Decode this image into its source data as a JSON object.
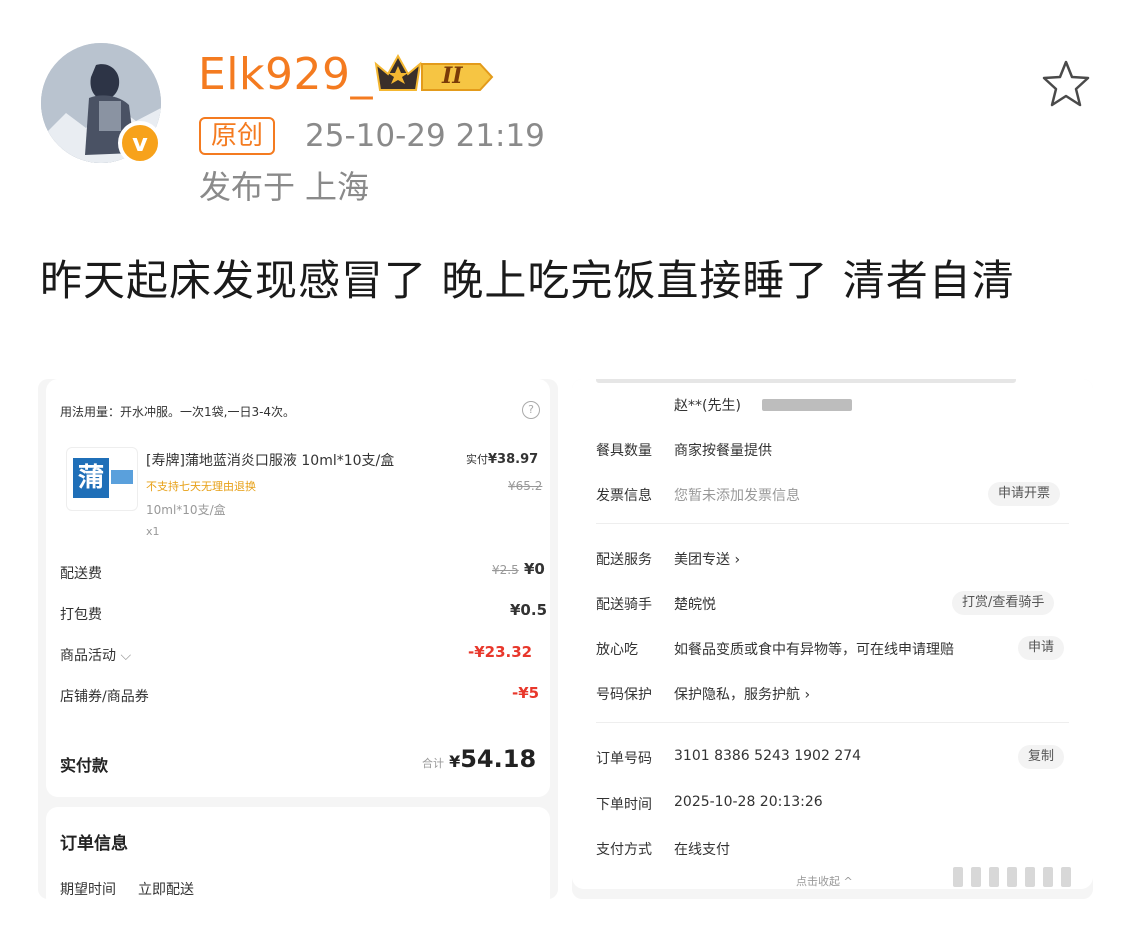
{
  "post": {
    "username": "Elk929_",
    "level_badge": "II",
    "verified_badge": "v",
    "original_tag": "原创",
    "timestamp": "25-10-29 21:19",
    "location_prefix": "发布于",
    "location": "上海",
    "text": "昨天起床发现感冒了 晚上吃完饭直接睡了 清者自清",
    "icons": [
      "avatar",
      "verified-badge-icon",
      "crown-level-icon",
      "favorite-star-icon"
    ]
  },
  "left_screenshot": {
    "usage": "用法用量：开水冲服。一次1袋,一日3-4次。",
    "product": {
      "name": "[寿牌]蒲地蓝消炎口服液 10ml*10支/盒",
      "notice": "不支持七天无理由退换",
      "spec": "10ml*10支/盒",
      "qty": "x1",
      "paid_label": "实付",
      "paid_price": "¥38.97",
      "original_price": "¥65.2",
      "image_char": "蒲"
    },
    "fees": [
      {
        "label": "配送费",
        "old": "¥2.5",
        "value": "¥0"
      },
      {
        "label": "打包费",
        "old": "",
        "value": "¥0.5"
      },
      {
        "label": "商品活动",
        "old": "",
        "value": "-¥23.32"
      },
      {
        "label": "店铺券/商品券",
        "old": "",
        "value": "-¥5"
      }
    ],
    "total_label": "实付款",
    "total_prefix": "合计",
    "total_currency": "¥",
    "total_value": "54.18",
    "order_info_title": "订单信息",
    "expected_label": "期望时间",
    "expected_value": "立即配送"
  },
  "right_screenshot": {
    "recipient": "赵**(先生)",
    "rows_a": [
      {
        "label": "餐具数量",
        "value": "商家按餐量提供",
        "action": ""
      },
      {
        "label": "发票信息",
        "value": "您暂未添加发票信息",
        "action": "申请开票"
      }
    ],
    "rows_b": [
      {
        "label": "配送服务",
        "value": "美团专送 ›",
        "action": ""
      },
      {
        "label": "配送骑手",
        "value": "楚皖悦",
        "action": "打赏/查看骑手"
      },
      {
        "label": "放心吃",
        "value": "如餐品变质或食中有异物等，可在线申请理赔",
        "action": "申请"
      },
      {
        "label": "号码保护",
        "value": "保护隐私，服务护航 ›",
        "action": ""
      }
    ],
    "rows_c": [
      {
        "label": "订单号码",
        "value": "3101 8386 5243 1902 274",
        "action": "复制"
      },
      {
        "label": "下单时间",
        "value": "2025-10-28 20:13:26",
        "action": ""
      },
      {
        "label": "支付方式",
        "value": "在线支付",
        "action": ""
      }
    ],
    "collapse": "点击收起 ^"
  },
  "colors": {
    "username": "#f47b20",
    "meta": "#8a8a8a",
    "price_red": "#e8372b",
    "notice_orange": "#e7a017"
  }
}
